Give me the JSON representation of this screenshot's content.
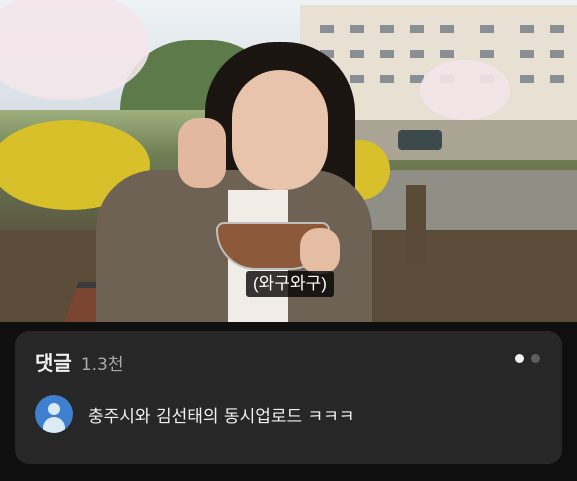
{
  "video": {
    "caption": "(와구와구)"
  },
  "comments": {
    "title": "댓글",
    "count": "1.3천",
    "page_indicator": {
      "pages": 2,
      "active": 1
    },
    "top_comment": {
      "avatar_icon": "person-icon",
      "avatar_color": "#3f7fd0",
      "text": "충주시와 김선태의 동시업로드 ㅋㅋㅋ"
    }
  },
  "colors": {
    "background": "#0f0f0f",
    "card": "#272727",
    "text_primary": "#f1f1f1",
    "text_secondary": "#aaaaaa"
  }
}
